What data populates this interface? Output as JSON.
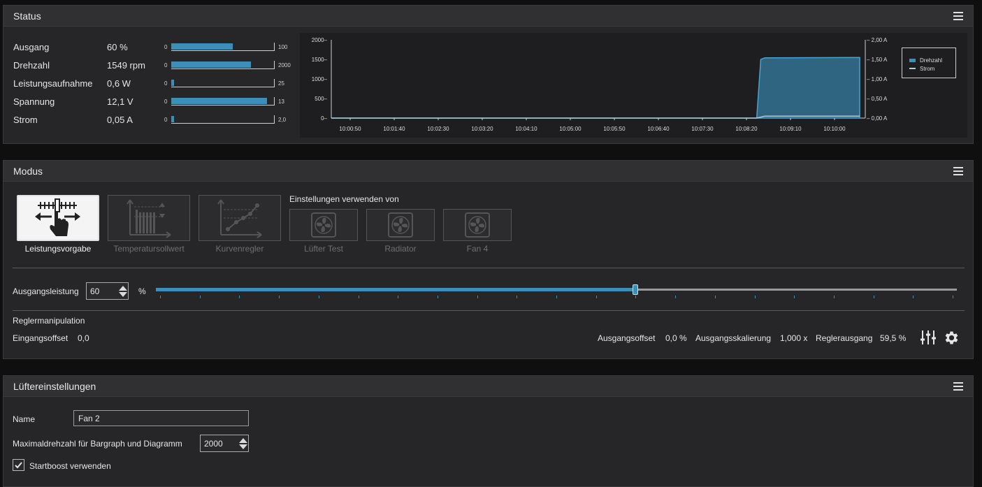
{
  "status": {
    "title": "Status",
    "rows": [
      {
        "label": "Ausgang",
        "value": "60 %",
        "min": "0",
        "max": "100",
        "fraction": 0.6
      },
      {
        "label": "Drehzahl",
        "value": "1549 rpm",
        "min": "0",
        "max": "2000",
        "fraction": 0.7745
      },
      {
        "label": "Leistungsaufnahme",
        "value": "0,6 W",
        "min": "0",
        "max": "25",
        "fraction": 0.024
      },
      {
        "label": "Spannung",
        "value": "12,1 V",
        "min": "0",
        "max": "13",
        "fraction": 0.93
      },
      {
        "label": "Strom",
        "value": "0,05 A",
        "min": "0",
        "max": "2,0",
        "fraction": 0.025
      }
    ]
  },
  "chart_data": {
    "type": "area",
    "x": [
      "10:00:50",
      "10:01:40",
      "10:02:30",
      "10:03:20",
      "10:04:10",
      "10:05:00",
      "10:05:50",
      "10:06:40",
      "10:07:30",
      "10:08:20",
      "10:09:10",
      "10:10:00"
    ],
    "left_ticks": [
      "2000",
      "1500",
      "1000",
      "500",
      "0"
    ],
    "right_ticks": [
      "2,00 A",
      "1,50 A",
      "1,00 A",
      "0,50 A",
      "0,00 A"
    ],
    "y_left_range": [
      0,
      2000
    ],
    "y_right_range": [
      0,
      2.0
    ],
    "series": [
      {
        "name": "Drehzahl",
        "axis": "left",
        "color": "#3b8fb8",
        "x": [
          0,
          628,
          634,
          640,
          780
        ],
        "y": [
          0,
          0,
          1500,
          1540,
          1549
        ]
      },
      {
        "name": "Strom",
        "axis": "right",
        "color": "#b8c8d0",
        "x": [
          0,
          628,
          640,
          780
        ],
        "y": [
          0,
          0,
          0.05,
          0.05
        ]
      }
    ],
    "legend": "right"
  },
  "modus": {
    "title": "Modus",
    "modes": [
      {
        "label": "Leistungsvorgabe",
        "active": true
      },
      {
        "label": "Temperatursollwert",
        "active": false
      },
      {
        "label": "Kurvenregler",
        "active": false
      }
    ],
    "sources_heading": "Einstellungen verwenden von",
    "sources": [
      "Lüfter Test",
      "Radiator",
      "Fan 4"
    ],
    "output_label": "Ausgangsleistung",
    "output_value": "60",
    "output_unit": "%",
    "slider_fraction": 0.595,
    "manipulation_heading": "Reglermanipulation",
    "input_offset_label": "Eingangsoffset",
    "input_offset_value": "0,0",
    "output_offset_label": "Ausgangsoffset",
    "output_offset_value": "0,0 %",
    "output_scale_label": "Ausgangsskalierung",
    "output_scale_value": "1,000 x",
    "controller_output_label": "Reglerausgang",
    "controller_output_value": "59,5 %"
  },
  "luefter": {
    "title": "Lüftereinstellungen",
    "name_label": "Name",
    "name_value": "Fan 2",
    "max_rpm_label": "Maximaldrehzahl für Bargraph und Diagramm",
    "max_rpm_value": "2000",
    "startboost_label": "Startboost verwenden",
    "startboost_checked": true
  }
}
